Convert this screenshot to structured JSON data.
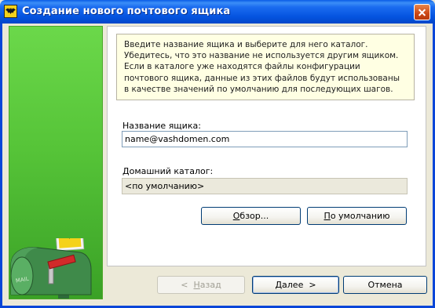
{
  "window": {
    "title": "Создание нового почтового ящика"
  },
  "info": {
    "text": "Введите название ящика и выберите для него каталог. Убедитесь, что это название не используется другим ящиком. Если в каталоге уже находятся файлы конфигурации почтового ящика, данные из этих файлов будут использованы в качестве значений по умолчанию для последующих шагов."
  },
  "mailbox_name": {
    "label": "Название ящика:",
    "value": "name@vashdomen.com"
  },
  "home_dir": {
    "label": "Домашний каталог:",
    "value": "<по умолчанию>"
  },
  "buttons": {
    "browse": {
      "label_u": "О",
      "label_rest": "бзор..."
    },
    "default": {
      "label_u": "П",
      "label_rest": "о умолчанию"
    },
    "back": {
      "label_pre": "<  ",
      "label_u": "Н",
      "label_rest": "азад"
    },
    "next": {
      "label_u": "Д",
      "label_rest": "алее  >"
    },
    "cancel": {
      "label": "Отмена"
    }
  },
  "art": {
    "mailbox_text": "MAIL",
    "colors": {
      "panel_green": "#56c438",
      "mailbox_green": "#3f8a4a",
      "stamp_yellow": "#f4d21a"
    }
  }
}
